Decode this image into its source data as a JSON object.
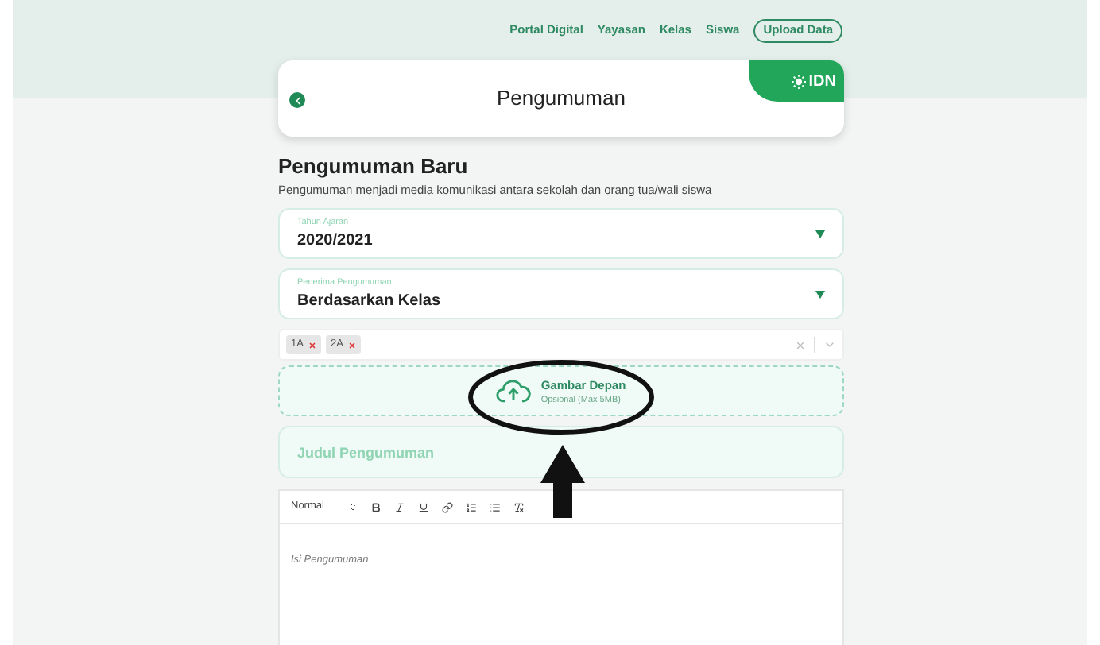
{
  "nav": {
    "links": [
      "Portal Digital",
      "Yayasan",
      "Kelas",
      "Siswa"
    ],
    "button": "Upload Data"
  },
  "header": {
    "title": "Pengumuman",
    "logo": "IDN"
  },
  "intro": {
    "title": "Pengumuman Baru",
    "subtitle": "Pengumuman menjadi media komunikasi antara sekolah dan orang tua/wali siswa"
  },
  "selects": [
    {
      "label": "Tahun Ajaran",
      "value": "2020/2021"
    },
    {
      "label": "Penerima Pengumuman",
      "value": "Berdasarkan Kelas"
    }
  ],
  "classes": {
    "tags": [
      "1A",
      "2A"
    ]
  },
  "upload": {
    "title": "Gambar Depan",
    "hint": "Opsional (Max 5MB)"
  },
  "title_field": {
    "placeholder": "Judul Pengumuman"
  },
  "editor": {
    "format": "Normal",
    "placeholder": "Isi Pengumuman"
  }
}
